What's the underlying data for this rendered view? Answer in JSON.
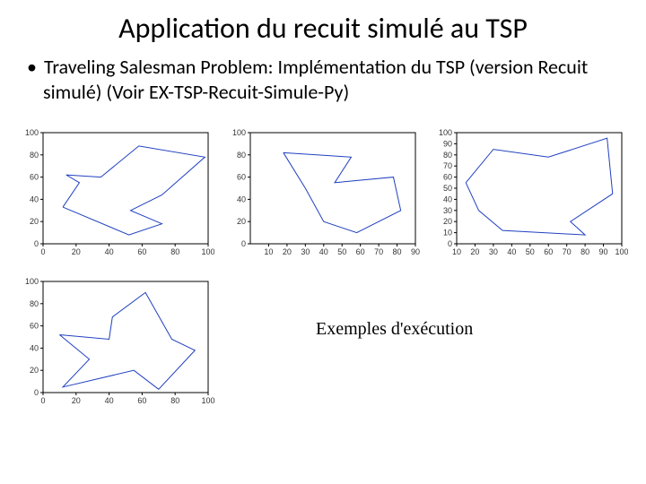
{
  "title": "Application du recuit simulé au TSP",
  "bullet": "Traveling Salesman Problem: Implémentation du TSP (version Recuit simulé) (Voir EX-TSP-Recuit-Simule-Py)",
  "caption": "Exemples d'exécution",
  "chart_data": [
    {
      "type": "line",
      "xlabel": "",
      "ylabel": "",
      "xlim": [
        0,
        100
      ],
      "ylim": [
        0,
        100
      ],
      "xticks": [
        0,
        20,
        40,
        60,
        80,
        100
      ],
      "yticks": [
        0,
        20,
        40,
        60,
        80,
        100
      ],
      "points": [
        [
          12,
          33
        ],
        [
          22,
          55
        ],
        [
          14,
          62
        ],
        [
          35,
          60
        ],
        [
          58,
          88
        ],
        [
          98,
          78
        ],
        [
          72,
          44
        ],
        [
          53,
          30
        ],
        [
          72,
          18
        ],
        [
          52,
          8
        ],
        [
          12,
          33
        ]
      ]
    },
    {
      "type": "line",
      "xlabel": "",
      "ylabel": "",
      "xlim": [
        0,
        90
      ],
      "ylim": [
        0,
        100
      ],
      "xticks": [
        10,
        20,
        30,
        40,
        50,
        60,
        70,
        80,
        90
      ],
      "yticks": [
        0,
        20,
        40,
        60,
        80,
        100
      ],
      "points": [
        [
          18,
          82
        ],
        [
          55,
          78
        ],
        [
          46,
          55
        ],
        [
          78,
          60
        ],
        [
          82,
          30
        ],
        [
          58,
          10
        ],
        [
          40,
          20
        ],
        [
          30,
          50
        ],
        [
          18,
          82
        ]
      ]
    },
    {
      "type": "line",
      "xlabel": "",
      "ylabel": "",
      "xlim": [
        10,
        100
      ],
      "ylim": [
        0,
        100
      ],
      "xticks": [
        10,
        20,
        30,
        40,
        50,
        60,
        70,
        80,
        90,
        100
      ],
      "yticks": [
        0,
        10,
        20,
        30,
        40,
        50,
        60,
        70,
        80,
        90,
        100
      ],
      "points": [
        [
          15,
          55
        ],
        [
          30,
          85
        ],
        [
          60,
          78
        ],
        [
          92,
          95
        ],
        [
          95,
          45
        ],
        [
          72,
          20
        ],
        [
          80,
          8
        ],
        [
          35,
          12
        ],
        [
          22,
          30
        ],
        [
          15,
          55
        ]
      ]
    },
    {
      "type": "line",
      "xlabel": "",
      "ylabel": "",
      "xlim": [
        0,
        100
      ],
      "ylim": [
        0,
        100
      ],
      "xticks": [
        0,
        20,
        40,
        60,
        80,
        100
      ],
      "yticks": [
        0,
        20,
        40,
        60,
        80,
        100
      ],
      "points": [
        [
          10,
          52
        ],
        [
          28,
          30
        ],
        [
          12,
          5
        ],
        [
          55,
          20
        ],
        [
          70,
          3
        ],
        [
          92,
          38
        ],
        [
          78,
          48
        ],
        [
          62,
          90
        ],
        [
          42,
          68
        ],
        [
          40,
          48
        ],
        [
          10,
          52
        ]
      ]
    }
  ]
}
